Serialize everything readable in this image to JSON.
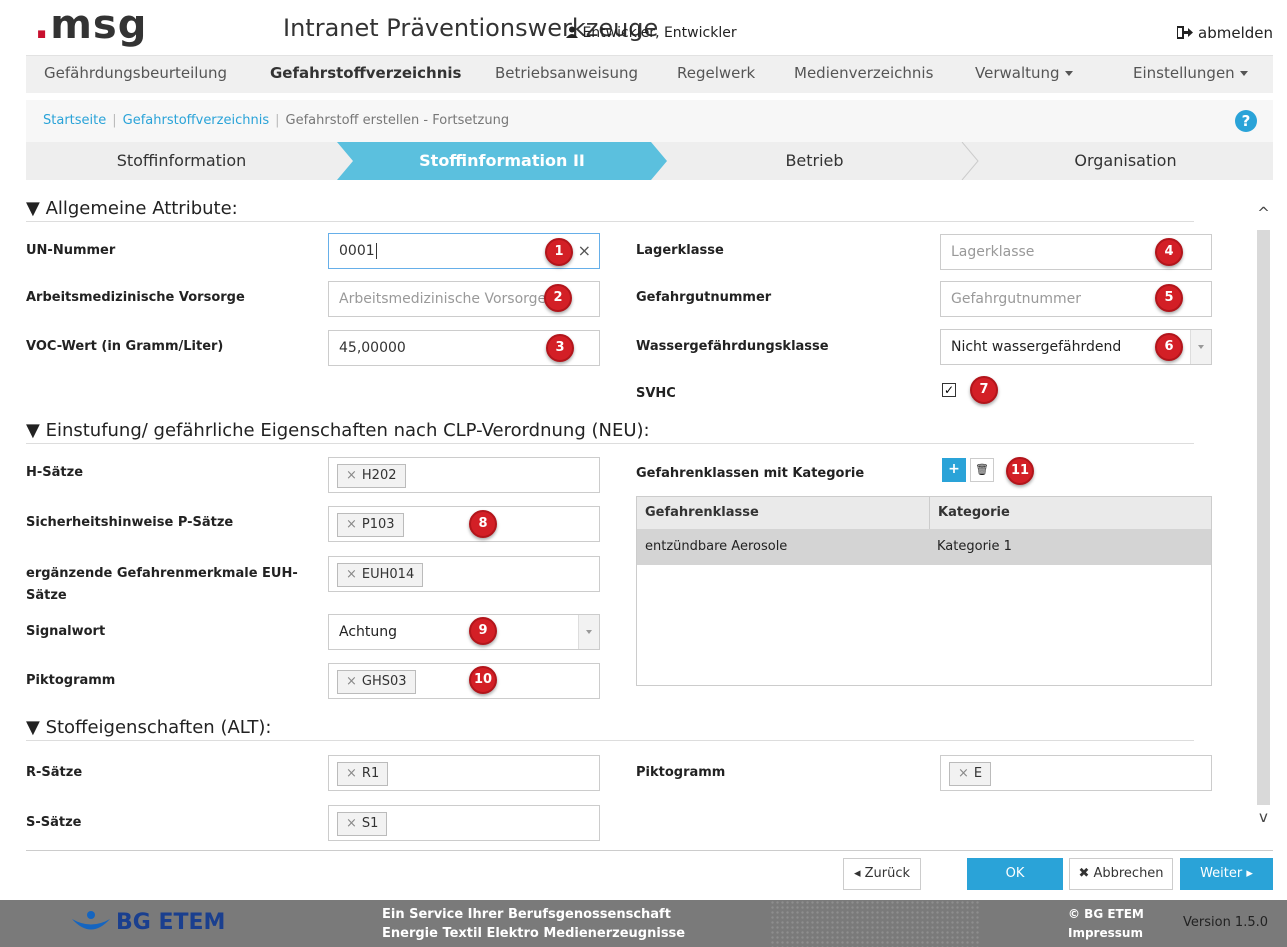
{
  "header": {
    "logo": "msg",
    "app_title": "Intranet Präventionswerkzeuge",
    "user": "Entwickler, Entwickler",
    "logout": "abmelden"
  },
  "nav": {
    "items": [
      {
        "label": "Gefährdungsbeurteilung"
      },
      {
        "label": "Gefahrstoffverzeichnis",
        "active": true
      },
      {
        "label": "Betriebsanweisung"
      },
      {
        "label": "Regelwerk"
      },
      {
        "label": "Medienverzeichnis"
      },
      {
        "label": "Verwaltung"
      },
      {
        "label": "Einstellungen"
      }
    ]
  },
  "breadcrumb": {
    "home": "Startseite",
    "section": "Gefahrstoffverzeichnis",
    "current": "Gefahrstoff erstellen - Fortsetzung",
    "help": "?"
  },
  "wizard": {
    "steps": [
      "Stoffinformation",
      "Stoffinformation II",
      "Betrieb",
      "Organisation"
    ],
    "active_step": "Stoffinformation II",
    "active_color": "#5bc0de"
  },
  "section_general": {
    "title": "▼ Allgemeine Attribute:",
    "un_nummer": {
      "label": "UN-Nummer",
      "value": "0001"
    },
    "arbeitsmed": {
      "label": "Arbeitsmedizinische Vorsorge",
      "placeholder": "Arbeitsmedizinische Vorsorge"
    },
    "voc": {
      "label": "VOC-Wert (in Gramm/Liter)",
      "value": "45,00000"
    },
    "lagerklasse": {
      "label": "Lagerklasse",
      "placeholder": "Lagerklasse"
    },
    "gefahrgut": {
      "label": "Gefahrgutnummer",
      "placeholder": "Gefahrgutnummer"
    },
    "wgk": {
      "label": "Wassergefährdungsklasse",
      "value": "Nicht wassergefährdend"
    },
    "svhc": {
      "label": "SVHC",
      "checked": true,
      "mark": "✓"
    }
  },
  "section_clp": {
    "title": "▼ Einstufung/ gefährliche Eigenschaften nach CLP-Verordnung (NEU):",
    "h_saetze": {
      "label": "H-Sätze",
      "tag": "H202"
    },
    "p_saetze": {
      "label": "Sicherheitshinweise P-Sätze",
      "tag": "P103"
    },
    "euh_label_1": "ergänzende Gefahrenmerkmale EUH-",
    "euh_label_2": "Sätze",
    "euh_tag": "EUH014",
    "signalwort": {
      "label": "Signalwort",
      "value": "Achtung"
    },
    "piktogramm": {
      "label": "Piktogramm",
      "tag": "GHS03"
    },
    "gefahrenklassen": {
      "label": "Gefahrenklassen mit Kategorie",
      "add": "+",
      "delete": "🗑",
      "columns": [
        "Gefahrenklasse",
        "Kategorie"
      ],
      "rows": [
        [
          "entzündbare Aerosole",
          "Kategorie 1"
        ]
      ]
    }
  },
  "section_old": {
    "title": "▼ Stoffeigenschaften (ALT):",
    "r_saetze": {
      "label": "R-Sätze",
      "tag": "R1"
    },
    "s_saetze": {
      "label": "S-Sätze",
      "tag": "S1"
    },
    "piktogramm": {
      "label": "Piktogramm",
      "tag": "E"
    }
  },
  "badges": [
    "1",
    "2",
    "3",
    "4",
    "5",
    "6",
    "7",
    "8",
    "9",
    "10",
    "11"
  ],
  "tag_remove": "×",
  "buttons": {
    "back": "◂ Zurück",
    "ok": "OK",
    "cancel": "✖ Abbrechen",
    "next": "Weiter ▸"
  },
  "scroll": {
    "up": "^",
    "down": "v"
  },
  "footer": {
    "brand": "BG ETEM",
    "service_1": "Ein Service Ihrer Berufsgenossenschaft",
    "service_2": "Energie Textil Elektro Medienerzeugnisse",
    "copyright": "© BG ETEM",
    "impressum": "Impressum",
    "version": "Version 1.5.0"
  },
  "colors": {
    "accent": "#2aa3d8",
    "badge": "#d31f26",
    "footer": "#7a7a7a"
  }
}
